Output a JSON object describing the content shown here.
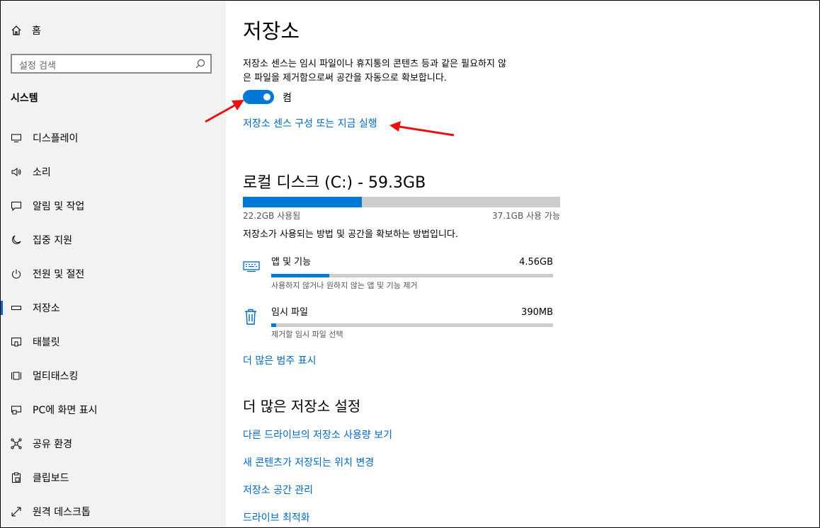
{
  "sidebar": {
    "home_label": "홈",
    "search_placeholder": "설정 검색",
    "section_title": "시스템",
    "items": [
      {
        "label": "디스플레이",
        "icon": "monitor-icon"
      },
      {
        "label": "소리",
        "icon": "speaker-icon"
      },
      {
        "label": "알림 및 작업",
        "icon": "notification-icon"
      },
      {
        "label": "집중 지원",
        "icon": "moon-icon"
      },
      {
        "label": "전원 및 절전",
        "icon": "power-icon"
      },
      {
        "label": "저장소",
        "icon": "storage-icon"
      },
      {
        "label": "태블릿",
        "icon": "tablet-icon"
      },
      {
        "label": "멀티태스킹",
        "icon": "multitasking-icon"
      },
      {
        "label": "PC에 화면 표시",
        "icon": "project-icon"
      },
      {
        "label": "공유 환경",
        "icon": "share-icon"
      },
      {
        "label": "클립보드",
        "icon": "clipboard-icon"
      },
      {
        "label": "원격 데스크톱",
        "icon": "remote-desktop-icon"
      }
    ],
    "active_item": "저장소"
  },
  "main": {
    "title": "저장소",
    "description_line1": "저장소 센스는 임시 파일이나 휴지통의 콘텐츠 등과 같은 필요하지 않",
    "description_line2": "은 파일을 제거함으로써 공간을 자동으로 확보합니다.",
    "toggle_label": "켬",
    "toggle_on": true,
    "configure_link": "저장소 센스 구성 또는 지금 실행",
    "disk": {
      "title": "로컬 디스크 (C:) - 59.3GB",
      "used_label": "22.2GB 사용됨",
      "free_label": "37.1GB 사용 가능",
      "used_fraction": 0.374
    },
    "usage_intro": "저장소가 사용되는 방법 및 공간을 확보하는 방법입니다.",
    "categories": [
      {
        "name": "앱 및 기능",
        "size": "4.56GB",
        "sub": "사용하지 않거나 원하지 않는 앱 및 기능 제거",
        "fraction": 0.205,
        "icon": "keyboard-icon"
      },
      {
        "name": "임시 파일",
        "size": "390MB",
        "sub": "제거할 임시 파일 선택",
        "fraction": 0.018,
        "icon": "trash-icon"
      }
    ],
    "more_categories_link": "더 많은 범주 표시",
    "more_settings_title": "더 많은 저장소 설정",
    "more_links": [
      "다른 드라이브의 저장소 사용량 보기",
      "새 콘텐츠가 저장되는 위치 변경",
      "저장소 공간 관리",
      "드라이브 최적화"
    ]
  },
  "annotation_color": "#e81010",
  "accent_color": "#0078d7"
}
